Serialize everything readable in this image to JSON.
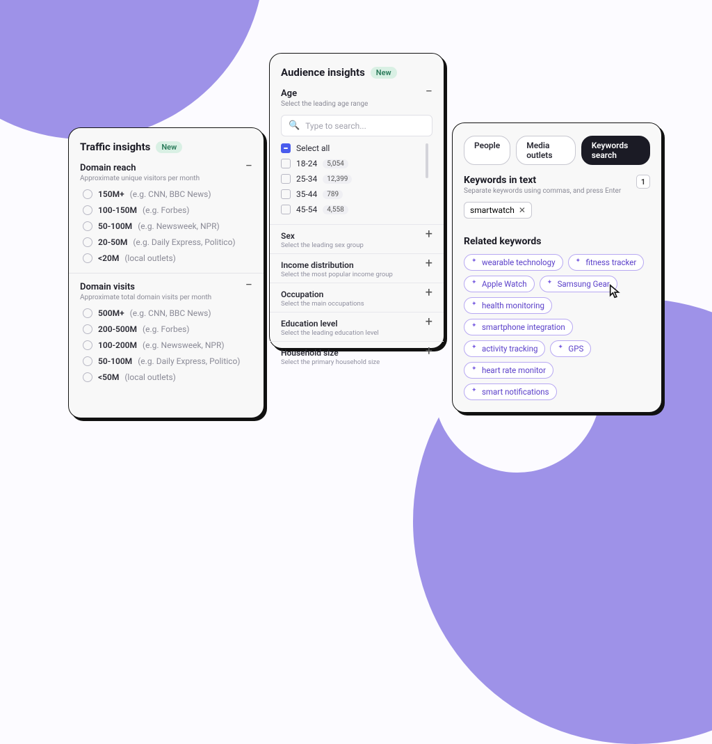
{
  "badge_new": "New",
  "traffic": {
    "title": "Traffic insights",
    "domain_reach": {
      "title": "Domain reach",
      "subtitle": "Approximate unique visitors per month",
      "options": [
        {
          "main": "150M+",
          "eg": "(e.g. CNN, BBC News)"
        },
        {
          "main": "100-150M",
          "eg": "(e.g. Forbes)"
        },
        {
          "main": "50-100M",
          "eg": "(e.g. Newsweek, NPR)"
        },
        {
          "main": "20-50M",
          "eg": "(e.g. Daily Express, Politico)"
        },
        {
          "main": "<20M",
          "eg": "(local outlets)"
        }
      ]
    },
    "domain_visits": {
      "title": "Domain visits",
      "subtitle": "Approximate total domain visits per month",
      "options": [
        {
          "main": "500M+",
          "eg": "(e.g. CNN, BBC News)"
        },
        {
          "main": "200-500M",
          "eg": "(e.g. Forbes)"
        },
        {
          "main": "100-200M",
          "eg": "(e.g. Newsweek, NPR)"
        },
        {
          "main": "50-100M",
          "eg": "(e.g. Daily Express, Politico)"
        },
        {
          "main": "<50M",
          "eg": "(local outlets)"
        }
      ]
    }
  },
  "audience": {
    "title": "Audience insights",
    "age": {
      "title": "Age",
      "subtitle": "Select the leading age range",
      "search_placeholder": "Type to search...",
      "select_all": "Select all",
      "options": [
        {
          "label": "18-24",
          "count": "5,054"
        },
        {
          "label": "25-34",
          "count": "12,399"
        },
        {
          "label": "35-44",
          "count": "789"
        },
        {
          "label": "45-54",
          "count": "4,558"
        }
      ]
    },
    "sections": [
      {
        "title": "Sex",
        "subtitle": "Select the leading sex group"
      },
      {
        "title": "Income distribution",
        "subtitle": "Select the most popular income group"
      },
      {
        "title": "Occupation",
        "subtitle": "Select the main occupations"
      },
      {
        "title": "Education level",
        "subtitle": "Select the leading education level"
      },
      {
        "title": "Household size",
        "subtitle": "Select the primary household size"
      }
    ]
  },
  "keywords": {
    "tabs": {
      "people": "People",
      "media": "Media outlets",
      "search": "Keywords search"
    },
    "panel": {
      "title": "Keywords in text",
      "subtitle": "Separate keywords using commas, and press Enter",
      "count": "1",
      "token": "smartwatch"
    },
    "related_title": "Related keywords",
    "related": [
      "wearable technology",
      "fitness tracker",
      "Apple Watch",
      "Samsung Gear",
      "health monitoring",
      "smartphone integration",
      "activity tracking",
      "GPS",
      "heart rate monitor",
      "smart notifications"
    ]
  }
}
